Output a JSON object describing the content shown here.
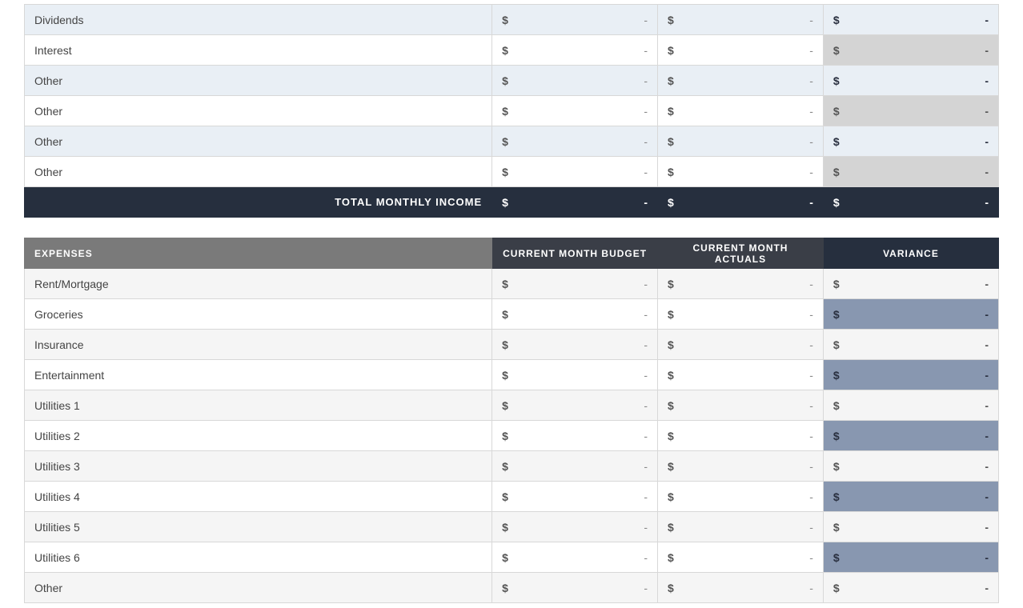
{
  "income": {
    "rows": [
      {
        "label": "Dividends",
        "budget": "-",
        "actuals": "-",
        "variance": "-",
        "alt": "blue"
      },
      {
        "label": "Interest",
        "budget": "-",
        "actuals": "-",
        "variance": "-",
        "alt": "plain"
      },
      {
        "label": "Other",
        "budget": "-",
        "actuals": "-",
        "variance": "-",
        "alt": "blue"
      },
      {
        "label": "Other",
        "budget": "-",
        "actuals": "-",
        "variance": "-",
        "alt": "plain"
      },
      {
        "label": "Other",
        "budget": "-",
        "actuals": "-",
        "variance": "-",
        "alt": "blue"
      },
      {
        "label": "Other",
        "budget": "-",
        "actuals": "-",
        "variance": "-",
        "alt": "plain"
      }
    ],
    "total_label": "TOTAL MONTHLY INCOME",
    "total_budget": "-",
    "total_actuals": "-",
    "total_variance": "-"
  },
  "expenses": {
    "headers": {
      "label": "EXPENSES",
      "budget": "CURRENT MONTH BUDGET",
      "actuals": "CURRENT MONTH ACTUALS",
      "variance": "VARIANCE"
    },
    "rows": [
      {
        "label": "Rent/Mortgage",
        "budget": "-",
        "actuals": "-",
        "variance": "-",
        "alt": "gray"
      },
      {
        "label": "Groceries",
        "budget": "-",
        "actuals": "-",
        "variance": "-",
        "alt": "plain"
      },
      {
        "label": "Insurance",
        "budget": "-",
        "actuals": "-",
        "variance": "-",
        "alt": "gray"
      },
      {
        "label": "Entertainment",
        "budget": "-",
        "actuals": "-",
        "variance": "-",
        "alt": "plain"
      },
      {
        "label": "Utilities 1",
        "budget": "-",
        "actuals": "-",
        "variance": "-",
        "alt": "gray"
      },
      {
        "label": "Utilities 2",
        "budget": "-",
        "actuals": "-",
        "variance": "-",
        "alt": "plain"
      },
      {
        "label": "Utilities 3",
        "budget": "-",
        "actuals": "-",
        "variance": "-",
        "alt": "gray"
      },
      {
        "label": "Utilities 4",
        "budget": "-",
        "actuals": "-",
        "variance": "-",
        "alt": "plain"
      },
      {
        "label": "Utilities 5",
        "budget": "-",
        "actuals": "-",
        "variance": "-",
        "alt": "gray"
      },
      {
        "label": "Utilities 6",
        "budget": "-",
        "actuals": "-",
        "variance": "-",
        "alt": "plain"
      },
      {
        "label": "Other",
        "budget": "-",
        "actuals": "-",
        "variance": "-",
        "alt": "gray"
      }
    ]
  },
  "currency": "$"
}
